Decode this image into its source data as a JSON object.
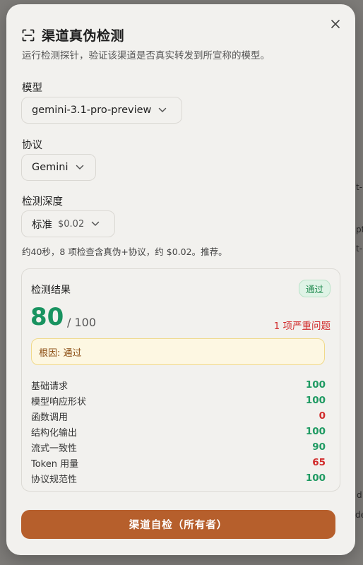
{
  "dialog": {
    "title": "渠道真伪检测",
    "subtitle": "运行检测探针，验证该渠道是否真实转发到所宣称的模型。"
  },
  "model": {
    "label": "模型",
    "value": "gemini-3.1-pro-preview"
  },
  "protocol": {
    "label": "协议",
    "value": "Gemini"
  },
  "depth": {
    "label": "检测深度",
    "value": "标准",
    "price": "$0.02"
  },
  "hint": "约40秒，8 项检查含真伪+协议，约 $0.02。推荐。",
  "result": {
    "title": "检测结果",
    "badge": "通过",
    "score": "80",
    "score_max": "/ 100",
    "issues": "1 项严重问题",
    "root_cause": "根因: 通过",
    "metrics": [
      {
        "name": "基础请求",
        "value": "100",
        "color": "#1f9a62"
      },
      {
        "name": "模型响应形状",
        "value": "100",
        "color": "#1f9a62"
      },
      {
        "name": "函数调用",
        "value": "0",
        "color": "#d12b2b"
      },
      {
        "name": "结构化输出",
        "value": "100",
        "color": "#1f9a62"
      },
      {
        "name": "流式一致性",
        "value": "90",
        "color": "#1f9a62"
      },
      {
        "name": "Token 用量",
        "value": "65",
        "color": "#d12b2b"
      },
      {
        "name": "协议规范性",
        "value": "100",
        "color": "#1f9a62"
      }
    ]
  },
  "cta_label": "渠道自检（所有者）",
  "background_fragments": [
    "t-",
    "pt",
    "t-",
    "d",
    "de"
  ],
  "icons": {
    "header": "scan-icon",
    "close": "close-icon",
    "dropdown": "chevron-down-icon"
  }
}
